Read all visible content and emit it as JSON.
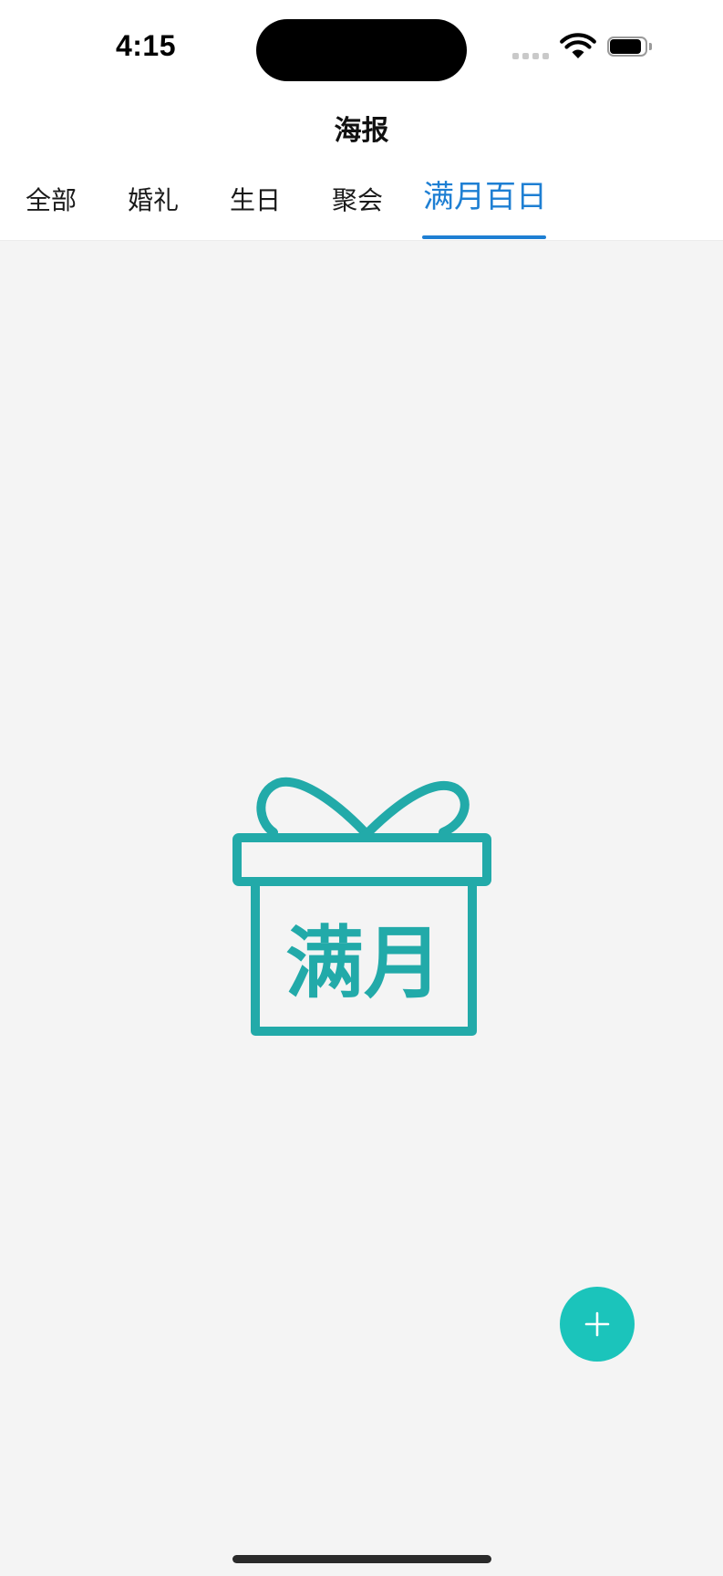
{
  "status_bar": {
    "time": "4:15"
  },
  "header": {
    "title": "海报"
  },
  "tabs": [
    {
      "label": "全部"
    },
    {
      "label": "婚礼"
    },
    {
      "label": "生日"
    },
    {
      "label": "聚会"
    },
    {
      "label": "满月百日"
    }
  ],
  "active_tab": "满月百日",
  "empty_state": {
    "illustration_text": "满月",
    "icon": "gift-box-icon"
  },
  "fab": {
    "icon": "plus-icon"
  },
  "colors": {
    "accent_blue": "#1e7fd3",
    "illustration_teal": "#22aaa9",
    "fab_teal": "#1bc4bb",
    "background": "#f4f4f4"
  }
}
